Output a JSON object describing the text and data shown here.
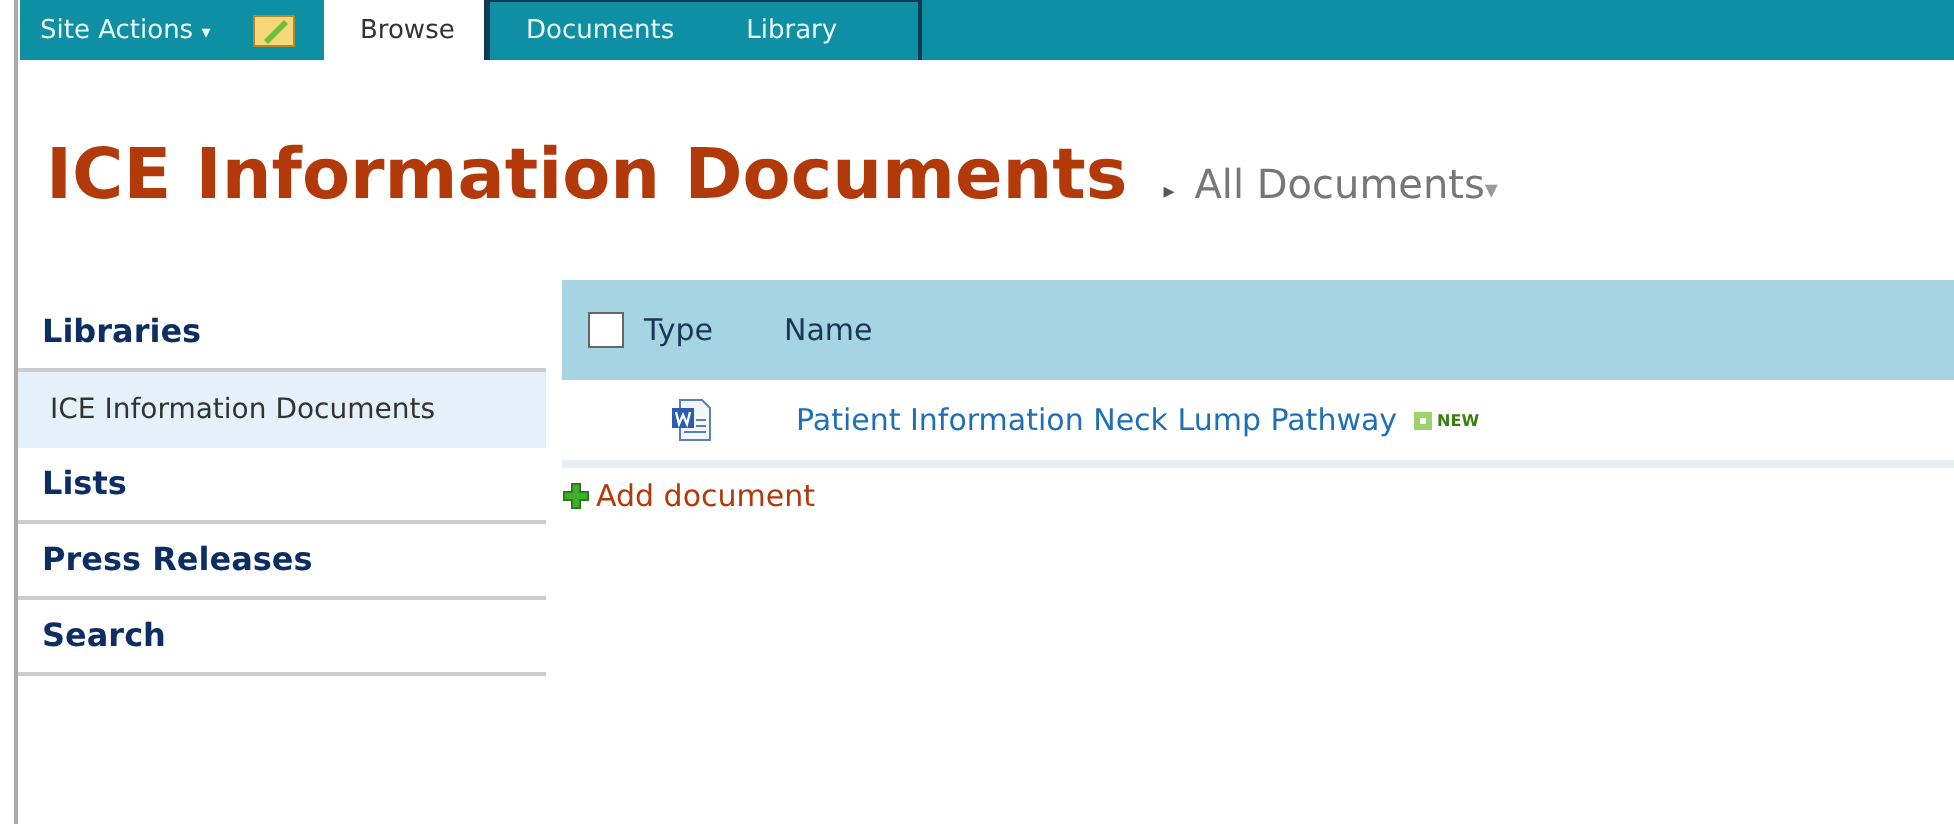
{
  "ribbon": {
    "site_actions": "Site Actions",
    "site_actions_caret": "▾",
    "tabs": [
      {
        "label": "Browse",
        "selected": true
      },
      {
        "label": "Documents",
        "selected": false
      },
      {
        "label": "Library",
        "selected": false
      }
    ]
  },
  "title": "ICE Information Documents",
  "breadcrumb": {
    "separator": "▸",
    "view": "All Documents",
    "caret": "▾"
  },
  "sidebar": {
    "items": [
      {
        "kind": "heading",
        "label": "Libraries",
        "selected": false
      },
      {
        "kind": "link",
        "label": "ICE Information Documents",
        "selected": true
      },
      {
        "kind": "heading",
        "label": "Lists",
        "selected": false
      },
      {
        "kind": "heading",
        "label": "Press Releases",
        "selected": false
      },
      {
        "kind": "heading",
        "label": "Search",
        "selected": false
      }
    ]
  },
  "table": {
    "select_all": {
      "checked": false
    },
    "columns": [
      "Type",
      "Name"
    ],
    "rows": [
      {
        "kind": "word",
        "name": "Patient Information Neck Lump Pathway",
        "badge": "NEW"
      }
    ]
  },
  "add_link": "Add document"
}
